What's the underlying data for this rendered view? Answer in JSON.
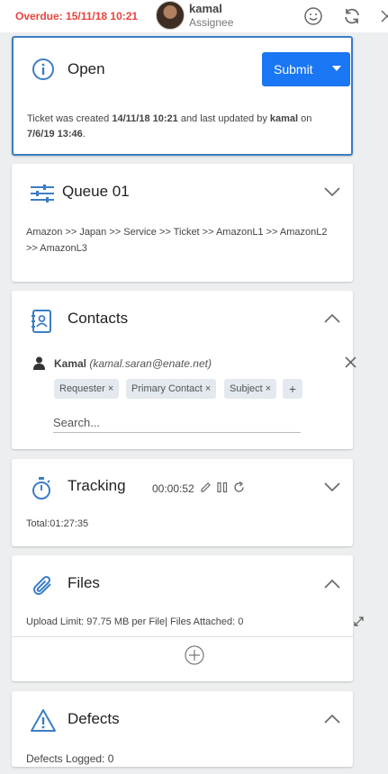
{
  "header": {
    "overdue": "Overdue: 15/11/18 10:21",
    "user_name": "kamal",
    "user_role": "Assignee"
  },
  "status_card": {
    "title": "Open",
    "submit_label": "Submit",
    "text_created_prefix": "Ticket was created ",
    "created_at": "14/11/18 10:21",
    "text_updated_mid": " and last updated by ",
    "updated_by": "kamal",
    "text_on": " on",
    "updated_at": "7/6/19 13:46",
    "text_end": "."
  },
  "queue_card": {
    "title": "Queue 01",
    "path_line1": "Amazon >> Japan >> Service >> Ticket >> AmazonL1 >> AmazonL2",
    "path_line2": ">> AmazonL3"
  },
  "contacts_card": {
    "title": "Contacts",
    "contact_name": "Kamal",
    "contact_email": "(kamal.saran@enate.net)",
    "tags": [
      "Requester",
      "Primary Contact",
      "Subject"
    ],
    "search_placeholder": "Search..."
  },
  "tracking_card": {
    "title": "Tracking",
    "timer": "00:00:52",
    "total": "Total:01:27:35"
  },
  "files_card": {
    "title": "Files",
    "upload_info": "Upload Limit: 97.75 MB per File| Files Attached: 0"
  },
  "defects_card": {
    "title": "Defects",
    "logged": "Defects Logged: 0"
  },
  "colors": {
    "accent": "#1976f5",
    "icon_blue": "#3c7dc5",
    "overdue_red": "#e8453c"
  }
}
